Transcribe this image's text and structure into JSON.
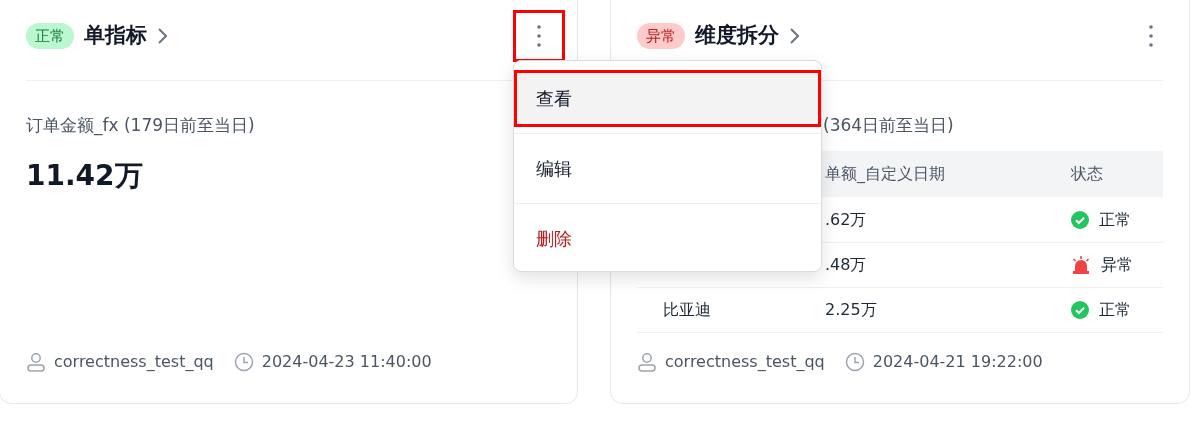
{
  "cards": [
    {
      "status": {
        "label": "正常",
        "kind": "normal"
      },
      "title": "单指标",
      "menu_button": {
        "highlighted": true
      },
      "metric": "订单金额_fx (179日前至当日)",
      "value": "11.42万",
      "owner": "correctness_test_qq",
      "time": "2024-04-23 11:40:00"
    },
    {
      "status": {
        "label": "异常",
        "kind": "abnormal"
      },
      "title": "维度拆分",
      "menu_button": {
        "highlighted": false
      },
      "metric": "(364日前至当日)",
      "table": {
        "columns": [
          "单额_自定义日期",
          "状态"
        ],
        "rows": [
          {
            "value": ".62万",
            "status": {
              "label": "正常",
              "kind": "normal"
            }
          },
          {
            "value": ".48万",
            "status": {
              "label": "异常",
              "kind": "abnormal"
            }
          },
          {
            "name": "比亚迪",
            "value": "2.25万",
            "status": {
              "label": "正常",
              "kind": "normal"
            }
          }
        ]
      },
      "owner": "correctness_test_qq",
      "time": "2024-04-21 19:22:00"
    }
  ],
  "menu": {
    "items": [
      {
        "label": "查看",
        "kind": "normal",
        "selected": true
      },
      {
        "label": "编辑",
        "kind": "normal",
        "selected": false
      },
      {
        "label": "删除",
        "kind": "danger",
        "selected": false
      }
    ]
  }
}
